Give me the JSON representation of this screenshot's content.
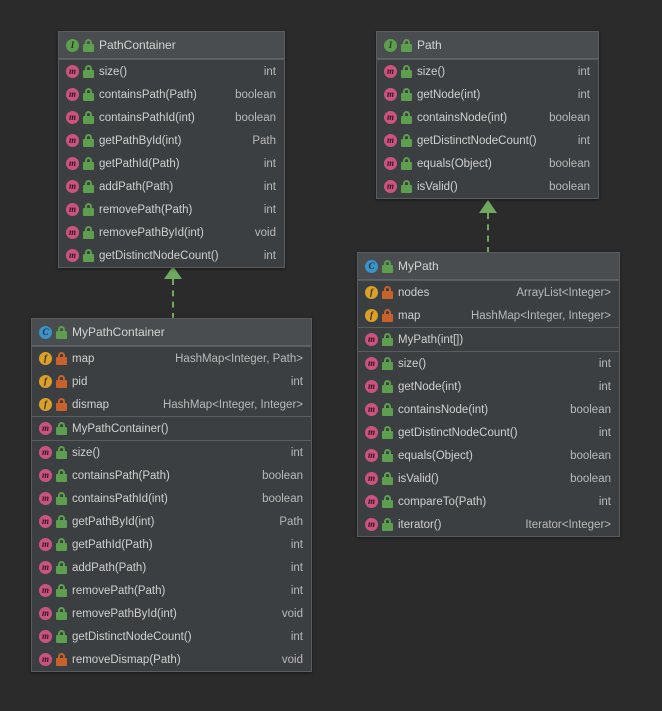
{
  "diagram": {
    "kind": "uml-class-diagram",
    "background": "#2b2b2b",
    "accent_relation_color": "#6fa85f"
  },
  "boxes": [
    {
      "id": "path-container",
      "name": "PathContainer",
      "stereotype": "interface",
      "icon": "interface-icon",
      "visibility": "public",
      "sections": [
        {
          "kind": "methods",
          "members": [
            {
              "icon": "method-icon",
              "visibility": "public",
              "name": "size()",
              "type": "int"
            },
            {
              "icon": "method-icon",
              "visibility": "public",
              "name": "containsPath(Path)",
              "type": "boolean"
            },
            {
              "icon": "method-icon",
              "visibility": "public",
              "name": "containsPathId(int)",
              "type": "boolean"
            },
            {
              "icon": "method-icon",
              "visibility": "public",
              "name": "getPathById(int)",
              "type": "Path"
            },
            {
              "icon": "method-icon",
              "visibility": "public",
              "name": "getPathId(Path)",
              "type": "int"
            },
            {
              "icon": "method-icon",
              "visibility": "public",
              "name": "addPath(Path)",
              "type": "int"
            },
            {
              "icon": "method-icon",
              "visibility": "public",
              "name": "removePath(Path)",
              "type": "int"
            },
            {
              "icon": "method-icon",
              "visibility": "public",
              "name": "removePathById(int)",
              "type": "void"
            },
            {
              "icon": "method-icon",
              "visibility": "public",
              "name": "getDistinctNodeCount()",
              "type": "int"
            }
          ]
        }
      ]
    },
    {
      "id": "path",
      "name": "Path",
      "stereotype": "interface",
      "icon": "interface-icon",
      "visibility": "public",
      "sections": [
        {
          "kind": "methods",
          "members": [
            {
              "icon": "method-icon",
              "visibility": "public",
              "name": "size()",
              "type": "int"
            },
            {
              "icon": "method-icon",
              "visibility": "public",
              "name": "getNode(int)",
              "type": "int"
            },
            {
              "icon": "method-icon",
              "visibility": "public",
              "name": "containsNode(int)",
              "type": "boolean"
            },
            {
              "icon": "method-icon",
              "visibility": "public",
              "name": "getDistinctNodeCount()",
              "type": "int"
            },
            {
              "icon": "method-icon",
              "visibility": "public",
              "name": "equals(Object)",
              "type": "boolean"
            },
            {
              "icon": "method-icon",
              "visibility": "public",
              "name": "isValid()",
              "type": "boolean"
            }
          ]
        }
      ]
    },
    {
      "id": "my-path-container",
      "name": "MyPathContainer",
      "stereotype": "class",
      "icon": "class-icon",
      "visibility": "public",
      "sections": [
        {
          "kind": "fields",
          "members": [
            {
              "icon": "field-icon",
              "visibility": "private",
              "name": "map",
              "type": "HashMap<Integer, Path>"
            },
            {
              "icon": "field-icon",
              "visibility": "private",
              "name": "pid",
              "type": "int"
            },
            {
              "icon": "field-icon",
              "visibility": "private",
              "name": "dismap",
              "type": "HashMap<Integer, Integer>"
            }
          ]
        },
        {
          "kind": "constructors",
          "members": [
            {
              "icon": "method-icon",
              "visibility": "public",
              "name": "MyPathContainer()",
              "type": ""
            }
          ]
        },
        {
          "kind": "methods",
          "members": [
            {
              "icon": "method-icon",
              "visibility": "public",
              "name": "size()",
              "type": "int"
            },
            {
              "icon": "method-icon",
              "visibility": "public",
              "name": "containsPath(Path)",
              "type": "boolean"
            },
            {
              "icon": "method-icon",
              "visibility": "public",
              "name": "containsPathId(int)",
              "type": "boolean"
            },
            {
              "icon": "method-icon",
              "visibility": "public",
              "name": "getPathById(int)",
              "type": "Path"
            },
            {
              "icon": "method-icon",
              "visibility": "public",
              "name": "getPathId(Path)",
              "type": "int"
            },
            {
              "icon": "method-icon",
              "visibility": "public",
              "name": "addPath(Path)",
              "type": "int"
            },
            {
              "icon": "method-icon",
              "visibility": "public",
              "name": "removePath(Path)",
              "type": "int"
            },
            {
              "icon": "method-icon",
              "visibility": "public",
              "name": "removePathById(int)",
              "type": "void"
            },
            {
              "icon": "method-icon",
              "visibility": "public",
              "name": "getDistinctNodeCount()",
              "type": "int"
            },
            {
              "icon": "method-icon",
              "visibility": "private",
              "name": "removeDismap(Path)",
              "type": "void"
            }
          ]
        }
      ]
    },
    {
      "id": "my-path",
      "name": "MyPath",
      "stereotype": "class",
      "icon": "class-icon",
      "visibility": "public",
      "sections": [
        {
          "kind": "fields",
          "members": [
            {
              "icon": "field-icon",
              "visibility": "private",
              "name": "nodes",
              "type": "ArrayList<Integer>"
            },
            {
              "icon": "field-icon",
              "visibility": "private",
              "name": "map",
              "type": "HashMap<Integer, Integer>"
            }
          ]
        },
        {
          "kind": "constructors",
          "members": [
            {
              "icon": "method-icon",
              "visibility": "public",
              "name": "MyPath(int[])",
              "type": ""
            }
          ]
        },
        {
          "kind": "methods",
          "members": [
            {
              "icon": "method-icon",
              "visibility": "public",
              "name": "size()",
              "type": "int"
            },
            {
              "icon": "method-icon",
              "visibility": "public",
              "name": "getNode(int)",
              "type": "int"
            },
            {
              "icon": "method-icon",
              "visibility": "public",
              "name": "containsNode(int)",
              "type": "boolean"
            },
            {
              "icon": "method-icon",
              "visibility": "public",
              "name": "getDistinctNodeCount()",
              "type": "int"
            },
            {
              "icon": "method-icon",
              "visibility": "public",
              "name": "equals(Object)",
              "type": "boolean"
            },
            {
              "icon": "method-icon",
              "visibility": "public",
              "name": "isValid()",
              "type": "boolean"
            },
            {
              "icon": "method-icon",
              "visibility": "public",
              "name": "compareTo(Path)",
              "type": "int"
            },
            {
              "icon": "method-icon",
              "visibility": "public",
              "name": "iterator()",
              "type": "Iterator<Integer>"
            }
          ]
        }
      ]
    }
  ],
  "relations": [
    {
      "id": "rel-mypathcontainer-pathcontainer",
      "type": "realization",
      "from": "MyPathContainer",
      "to": "PathContainer",
      "style": "dashed",
      "arrow": "closed-triangle"
    },
    {
      "id": "rel-mypath-path",
      "type": "realization",
      "from": "MyPath",
      "to": "Path",
      "style": "dashed",
      "arrow": "closed-triangle"
    }
  ]
}
